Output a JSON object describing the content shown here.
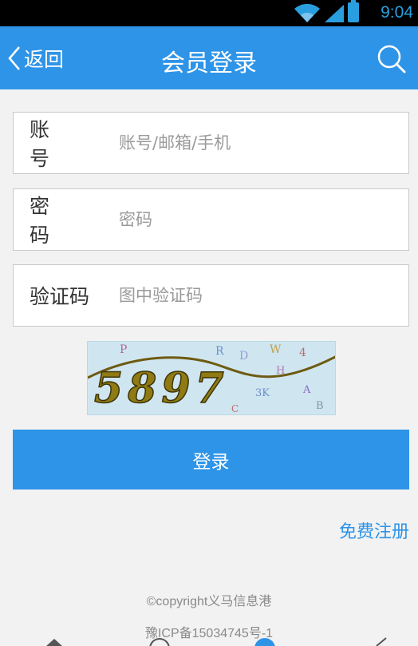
{
  "status_bar": {
    "time": "9:04"
  },
  "header": {
    "back_label": "返回",
    "title": "会员登录"
  },
  "form": {
    "account": {
      "label": "账 号",
      "placeholder": "账号/邮箱/手机"
    },
    "password": {
      "label": "密 码",
      "placeholder": "密码"
    },
    "captcha": {
      "label": "验证码",
      "placeholder": "图中验证码"
    },
    "captcha_image_text": "5897",
    "login_button": "登录",
    "register_link": "免费注册"
  },
  "footer": {
    "copyright": "©copyright义马信息港",
    "icp": "豫ICP备15034745号-1"
  },
  "colors": {
    "primary": "#2e94e8",
    "status_bar_bg": "#000000",
    "page_bg": "#f2f2f2"
  },
  "icons": [
    "wifi-icon",
    "signal-icon",
    "battery-icon",
    "back-chevron-icon",
    "search-icon",
    "home-icon",
    "circle-icon",
    "user-icon",
    "edit-icon"
  ]
}
